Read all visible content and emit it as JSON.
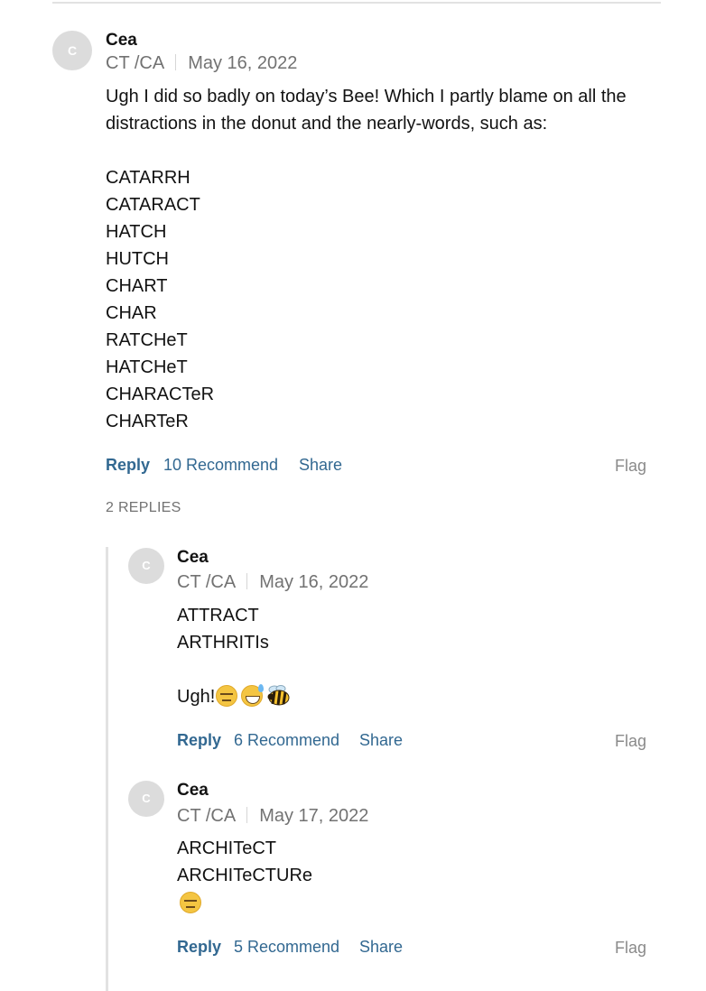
{
  "comments": [
    {
      "avatar_initial": "C",
      "name": "Cea",
      "location": "CT /CA",
      "date": "May 16, 2022",
      "lines": [
        "Ugh I did so badly on today’s Bee! Which I partly blame on all the",
        "distractions in the donut and the nearly-words, such as:",
        "CATARRH",
        "CATARACT",
        "HATCH",
        "HUTCH",
        "CHART",
        "CHAR",
        "RATCHeT",
        "HATCHeT",
        "CHARACTeR",
        "CHARTeR"
      ],
      "actions": {
        "reply": "Reply",
        "recommend": "10 Recommend",
        "share": "Share",
        "flag": "Flag"
      },
      "replies_count": "2 REPLIES"
    }
  ],
  "replies": [
    {
      "avatar_initial": "C",
      "name": "Cea",
      "location": "CT /CA",
      "date": "May 16, 2022",
      "lines": [
        "ATTRACT",
        "ARTHRITIs",
        "Ugh!"
      ],
      "emojis": [
        "expressionless-face",
        "grinning-sweat-face",
        "honeybee"
      ],
      "actions": {
        "reply": "Reply",
        "recommend": "6 Recommend",
        "share": "Share",
        "flag": "Flag"
      }
    },
    {
      "avatar_initial": "C",
      "name": "Cea",
      "location": "CT /CA",
      "date": "May 17, 2022",
      "lines": [
        "ARCHITeCT",
        "ARCHITeCTURe"
      ],
      "emojis": [
        "expressionless-face"
      ],
      "actions": {
        "reply": "Reply",
        "recommend": "5 Recommend",
        "share": "Share",
        "flag": "Flag"
      }
    }
  ],
  "colors": {
    "link": "#326891",
    "meta": "#727272",
    "flag": "#8a8a8a",
    "avatar_bg": "#dcdcdc",
    "rule": "#e2e2e2"
  }
}
